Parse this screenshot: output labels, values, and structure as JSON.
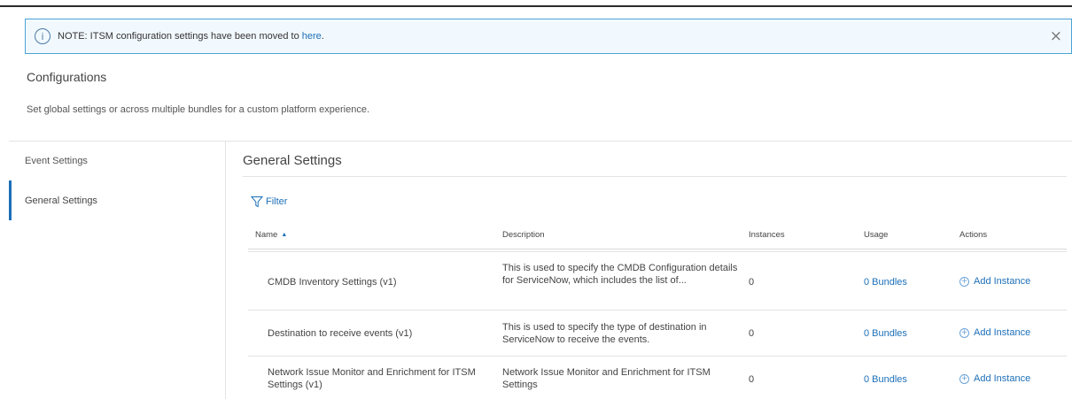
{
  "notice": {
    "text": "NOTE: ITSM configuration settings have been moved to ",
    "link": "here",
    "suffix": ".",
    "info_icon_glyph": "i",
    "close_glyph": "×"
  },
  "page": {
    "title": "Configurations",
    "subtitle": "Set global settings or across multiple bundles for a custom platform experience."
  },
  "sidebar": {
    "items": [
      {
        "label": "Event Settings",
        "active": false
      },
      {
        "label": "General Settings",
        "active": true
      }
    ]
  },
  "main": {
    "title": "General Settings",
    "filter_label": "Filter",
    "columns": {
      "name": "Name",
      "description": "Description",
      "instances": "Instances",
      "usage": "Usage",
      "actions": "Actions"
    },
    "sort_glyph": "▲",
    "rows": [
      {
        "name": "CMDB Inventory Settings (v1)",
        "description": "This is used to specify the CMDB Configuration details for ServiceNow, which includes the list of...",
        "instances": "0",
        "usage": "0 Bundles",
        "action": "Add Instance"
      },
      {
        "name": "Destination to receive events (v1)",
        "description": "This is used to specify the type of destination in ServiceNow to receive the events.",
        "instances": "0",
        "usage": "0 Bundles",
        "action": "Add Instance"
      },
      {
        "name": "Network Issue Monitor and Enrichment for ITSM Settings (v1)",
        "description": "Network Issue Monitor and Enrichment for ITSM Settings",
        "instances": "0",
        "usage": "0 Bundles",
        "action": "Add Instance"
      }
    ]
  },
  "colors": {
    "accent": "#1c6fb8",
    "notice_border": "#4aa3d6",
    "notice_bg": "#f2f9fe"
  }
}
